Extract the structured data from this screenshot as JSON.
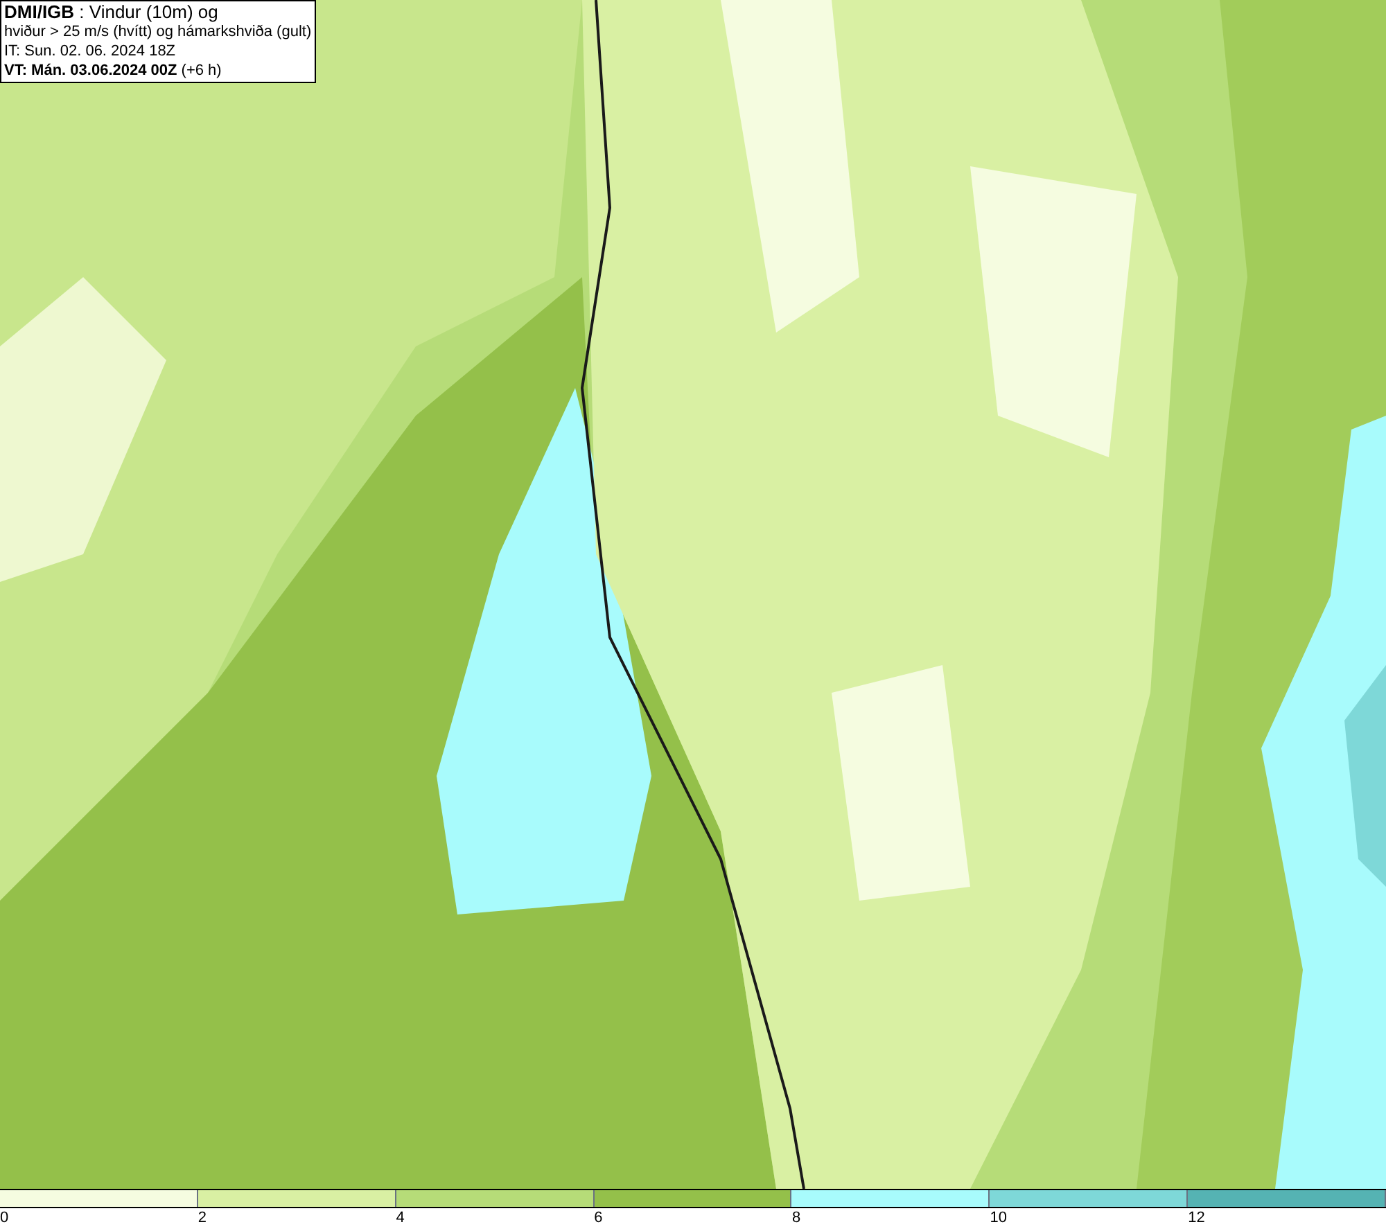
{
  "title_box": {
    "lines": [
      "**DMI/IGB** : Vindur (10m) og",
      "hviður > 25 m/s (hvítt) og hámarkshviða (gult)",
      "IT: Sun. 02. 06. 2024 18Z",
      "**VT: Mán. 03.06.2024 00Z** (+6 h)"
    ]
  },
  "legend": {
    "swatches": [
      {
        "color": "#f5fce0"
      },
      {
        "color": "#d9f0a3"
      },
      {
        "color": "#b6dc78"
      },
      {
        "color": "#94c04a"
      },
      {
        "color": "#a8fbfc"
      },
      {
        "color": "#7ed8d8"
      },
      {
        "color": "#55b3b3"
      }
    ],
    "labels": [
      "0",
      "2",
      "4",
      "6",
      "8",
      "10",
      "12"
    ]
  }
}
